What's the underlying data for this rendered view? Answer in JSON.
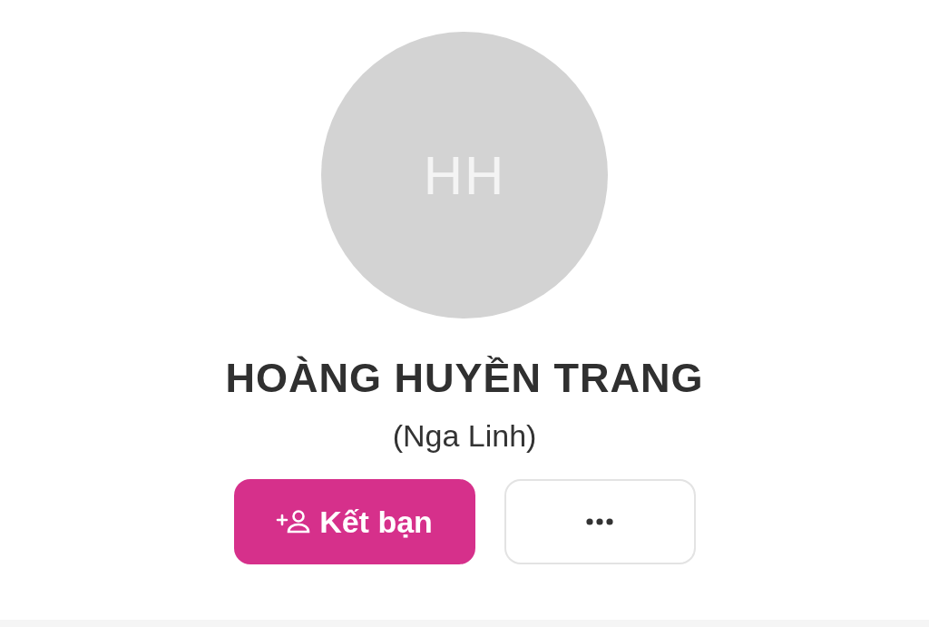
{
  "profile": {
    "avatar_initials": "HH",
    "name": "HOÀNG HUYỀN TRANG",
    "alias": "(Nga Linh)"
  },
  "buttons": [
    {
      "kind": "add-friend",
      "label": "Kết bạn"
    },
    {
      "kind": "more"
    }
  ]
}
